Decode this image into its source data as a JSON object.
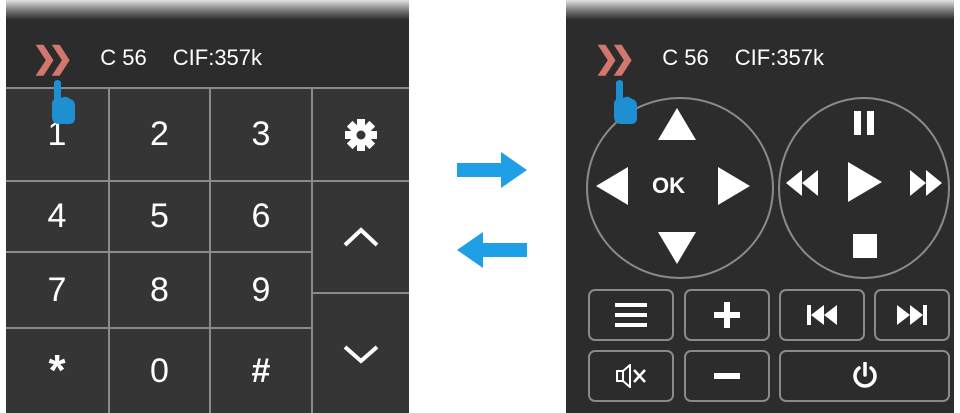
{
  "status": {
    "channel": "C 56",
    "info": "CIF:357k"
  },
  "keypad": {
    "keys": [
      "1",
      "2",
      "3",
      "4",
      "5",
      "6",
      "7",
      "8",
      "9",
      "*",
      "0",
      "#"
    ]
  },
  "colors": {
    "panel": "#2c2c2c",
    "border": "#8a8a8a",
    "accent_arrow": "#1fa0e6",
    "chevron": "#d2766e"
  },
  "icons": [
    "gear-icon",
    "chevron-up-icon",
    "chevron-down-icon",
    "menu-icon",
    "plus-icon",
    "minus-icon",
    "mute-icon",
    "prev-track-icon",
    "next-track-icon",
    "power-icon",
    "pause-icon",
    "play-icon",
    "rewind-icon",
    "fast-forward-icon",
    "stop-icon"
  ],
  "remote": {
    "ok_label": "OK"
  }
}
